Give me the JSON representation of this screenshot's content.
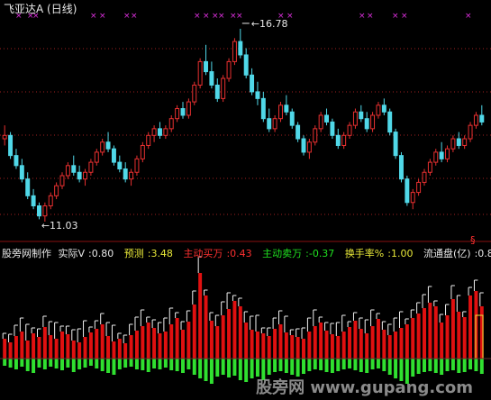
{
  "title": "飞亚达A (日线)",
  "watermark": "股旁网  www.gupang.com",
  "price_high_label": "16.78",
  "price_low_label": "11.03",
  "indicator": {
    "name": "股旁网制作",
    "items": [
      {
        "label": "实际V",
        "value": ":0.80",
        "color": "#e8e8e8"
      },
      {
        "label": "预测",
        "value": ":3.48",
        "color": "#e8e838"
      },
      {
        "label": "主动买万",
        "value": ":0.43",
        "color": "#ff3030"
      },
      {
        "label": "主动卖万",
        "value": ":-0.37",
        "color": "#20e020"
      },
      {
        "label": "换手率%",
        "value": ":1.00",
        "color": "#e8e838"
      },
      {
        "label": "流通盘(亿)",
        "value": ":0.8",
        "color": "#e8e8e8"
      }
    ]
  },
  "colors": {
    "up": "#e83030",
    "down": "#50d8e8",
    "buy": "#e01010",
    "sell": "#30e030",
    "marker": "#e030e0",
    "grid": "#a02020",
    "text": "#e8e8e8"
  },
  "chart_data": {
    "type": "candlestick",
    "price_ylim": [
      10.6,
      17.1
    ],
    "candles": [
      [
        13.5,
        13.9,
        13.3,
        13.6
      ],
      [
        13.6,
        13.7,
        12.9,
        13.0
      ],
      [
        13.0,
        13.2,
        12.6,
        12.7
      ],
      [
        12.7,
        12.9,
        12.2,
        12.3
      ],
      [
        12.3,
        12.5,
        11.7,
        11.8
      ],
      [
        11.8,
        12.0,
        11.4,
        11.5
      ],
      [
        11.5,
        11.6,
        11.1,
        11.2
      ],
      [
        11.2,
        11.6,
        11.03,
        11.5
      ],
      [
        11.5,
        11.9,
        11.4,
        11.8
      ],
      [
        11.8,
        12.2,
        11.7,
        12.1
      ],
      [
        12.1,
        12.5,
        12.0,
        12.4
      ],
      [
        12.4,
        12.8,
        12.3,
        12.7
      ],
      [
        12.7,
        13.0,
        12.4,
        12.5
      ],
      [
        12.5,
        12.7,
        12.2,
        12.3
      ],
      [
        12.3,
        12.6,
        12.1,
        12.5
      ],
      [
        12.5,
        12.9,
        12.4,
        12.8
      ],
      [
        12.8,
        13.2,
        12.7,
        13.1
      ],
      [
        13.1,
        13.5,
        13.0,
        13.4
      ],
      [
        13.4,
        13.7,
        13.1,
        13.2
      ],
      [
        13.2,
        13.3,
        12.7,
        12.8
      ],
      [
        12.8,
        13.0,
        12.5,
        12.6
      ],
      [
        12.6,
        12.8,
        12.2,
        12.3
      ],
      [
        12.3,
        12.6,
        12.1,
        12.5
      ],
      [
        12.5,
        13.0,
        12.4,
        12.9
      ],
      [
        12.9,
        13.4,
        12.8,
        13.3
      ],
      [
        13.3,
        13.7,
        13.2,
        13.6
      ],
      [
        13.6,
        13.9,
        13.4,
        13.8
      ],
      [
        13.8,
        14.0,
        13.5,
        13.6
      ],
      [
        13.6,
        13.9,
        13.5,
        13.8
      ],
      [
        13.8,
        14.2,
        13.7,
        14.1
      ],
      [
        14.1,
        14.5,
        14.0,
        14.4
      ],
      [
        14.4,
        14.6,
        14.1,
        14.2
      ],
      [
        14.2,
        14.7,
        14.1,
        14.6
      ],
      [
        14.6,
        15.2,
        14.5,
        15.1
      ],
      [
        15.1,
        15.9,
        15.0,
        15.8
      ],
      [
        15.8,
        16.3,
        15.4,
        15.5
      ],
      [
        15.5,
        15.8,
        15.0,
        15.1
      ],
      [
        15.1,
        15.3,
        14.6,
        14.7
      ],
      [
        14.7,
        15.4,
        14.6,
        15.3
      ],
      [
        15.3,
        15.9,
        15.2,
        15.8
      ],
      [
        15.8,
        16.5,
        15.7,
        16.4
      ],
      [
        16.4,
        16.78,
        15.9,
        16.0
      ],
      [
        16.0,
        16.2,
        15.3,
        15.4
      ],
      [
        15.4,
        15.6,
        14.8,
        14.9
      ],
      [
        14.9,
        15.2,
        14.5,
        14.7
      ],
      [
        14.7,
        14.9,
        14.0,
        14.1
      ],
      [
        14.1,
        14.4,
        13.7,
        13.8
      ],
      [
        13.8,
        14.2,
        13.7,
        14.1
      ],
      [
        14.1,
        14.6,
        14.0,
        14.5
      ],
      [
        14.5,
        14.8,
        14.2,
        14.3
      ],
      [
        14.3,
        14.4,
        13.8,
        13.9
      ],
      [
        13.9,
        14.0,
        13.4,
        13.5
      ],
      [
        13.5,
        13.6,
        13.0,
        13.1
      ],
      [
        13.1,
        13.5,
        12.9,
        13.4
      ],
      [
        13.4,
        13.9,
        13.3,
        13.8
      ],
      [
        13.8,
        14.3,
        13.7,
        14.2
      ],
      [
        14.2,
        14.4,
        13.9,
        14.0
      ],
      [
        14.0,
        14.1,
        13.5,
        13.6
      ],
      [
        13.6,
        13.8,
        13.2,
        13.3
      ],
      [
        13.3,
        13.7,
        13.2,
        13.6
      ],
      [
        13.6,
        14.0,
        13.5,
        13.9
      ],
      [
        13.9,
        14.4,
        13.8,
        14.3
      ],
      [
        14.3,
        14.5,
        14.0,
        14.1
      ],
      [
        14.1,
        14.3,
        13.7,
        13.8
      ],
      [
        13.8,
        14.3,
        13.7,
        14.2
      ],
      [
        14.2,
        14.6,
        14.1,
        14.5
      ],
      [
        14.5,
        14.7,
        14.2,
        14.3
      ],
      [
        14.3,
        14.4,
        13.6,
        13.7
      ],
      [
        13.7,
        13.8,
        12.9,
        13.0
      ],
      [
        13.0,
        13.1,
        12.2,
        12.3
      ],
      [
        12.3,
        12.4,
        11.5,
        11.6
      ],
      [
        11.6,
        12.0,
        11.4,
        11.9
      ],
      [
        11.9,
        12.3,
        11.8,
        12.2
      ],
      [
        12.2,
        12.6,
        12.1,
        12.5
      ],
      [
        12.5,
        12.9,
        12.4,
        12.8
      ],
      [
        12.8,
        13.2,
        12.7,
        13.1
      ],
      [
        13.1,
        13.4,
        12.8,
        12.9
      ],
      [
        12.9,
        13.3,
        12.8,
        13.2
      ],
      [
        13.2,
        13.6,
        13.1,
        13.5
      ],
      [
        13.5,
        13.7,
        13.2,
        13.3
      ],
      [
        13.3,
        13.6,
        13.2,
        13.5
      ],
      [
        13.5,
        14.0,
        13.4,
        13.9
      ],
      [
        13.9,
        14.3,
        13.8,
        14.2
      ],
      [
        14.2,
        14.5,
        13.9,
        14.0
      ]
    ],
    "volume": [
      [
        22,
        -8
      ],
      [
        18,
        -10
      ],
      [
        25,
        -12
      ],
      [
        30,
        -9
      ],
      [
        20,
        -14
      ],
      [
        28,
        -16
      ],
      [
        24,
        -10
      ],
      [
        35,
        -12
      ],
      [
        26,
        -9
      ],
      [
        22,
        -11
      ],
      [
        30,
        -13
      ],
      [
        27,
        -10
      ],
      [
        20,
        -15
      ],
      [
        18,
        -12
      ],
      [
        24,
        -10
      ],
      [
        29,
        -8
      ],
      [
        33,
        -11
      ],
      [
        38,
        -14
      ],
      [
        25,
        -16
      ],
      [
        19,
        -18
      ],
      [
        22,
        -12
      ],
      [
        17,
        -10
      ],
      [
        26,
        -9
      ],
      [
        31,
        -12
      ],
      [
        36,
        -13
      ],
      [
        40,
        -15
      ],
      [
        34,
        -11
      ],
      [
        28,
        -12
      ],
      [
        30,
        -10
      ],
      [
        38,
        -13
      ],
      [
        45,
        -14
      ],
      [
        32,
        -16
      ],
      [
        41,
        -12
      ],
      [
        60,
        -18
      ],
      [
        95,
        -22
      ],
      [
        70,
        -25
      ],
      [
        42,
        -28
      ],
      [
        36,
        -20
      ],
      [
        48,
        -18
      ],
      [
        55,
        -21
      ],
      [
        64,
        -19
      ],
      [
        58,
        -24
      ],
      [
        40,
        -26
      ],
      [
        32,
        -22
      ],
      [
        30,
        -20
      ],
      [
        28,
        -24
      ],
      [
        25,
        -18
      ],
      [
        33,
        -15
      ],
      [
        38,
        -14
      ],
      [
        29,
        -16
      ],
      [
        26,
        -18
      ],
      [
        24,
        -20
      ],
      [
        22,
        -17
      ],
      [
        30,
        -14
      ],
      [
        36,
        -12
      ],
      [
        40,
        -13
      ],
      [
        31,
        -15
      ],
      [
        27,
        -16
      ],
      [
        25,
        -14
      ],
      [
        30,
        -12
      ],
      [
        35,
        -11
      ],
      [
        42,
        -13
      ],
      [
        33,
        -15
      ],
      [
        28,
        -16
      ],
      [
        36,
        -12
      ],
      [
        44,
        -11
      ],
      [
        32,
        -14
      ],
      [
        26,
        -18
      ],
      [
        30,
        -22
      ],
      [
        34,
        -25
      ],
      [
        38,
        -28
      ],
      [
        45,
        -20
      ],
      [
        50,
        -17
      ],
      [
        56,
        -15
      ],
      [
        62,
        -14
      ],
      [
        58,
        -16
      ],
      [
        40,
        -18
      ],
      [
        48,
        -14
      ],
      [
        66,
        -13
      ],
      [
        52,
        -16
      ],
      [
        46,
        -15
      ],
      [
        70,
        -12
      ],
      [
        75,
        -14
      ],
      [
        58,
        -17
      ]
    ],
    "annotations": {
      "high": "16.78",
      "low": "11.03"
    }
  }
}
